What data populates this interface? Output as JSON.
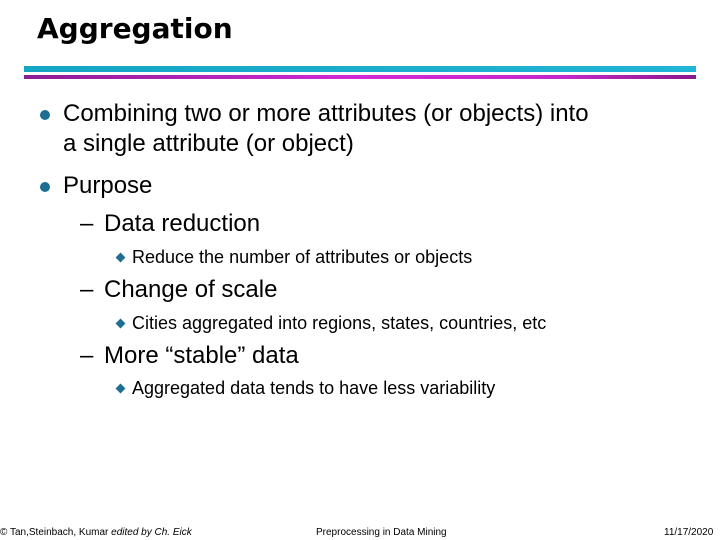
{
  "slide": {
    "title": "Aggregation",
    "bullets": [
      {
        "line1": "Combining two or more attributes (or objects) into",
        "line2": "a single attribute (or object)"
      },
      {
        "line1": "Purpose"
      }
    ],
    "sub_points": [
      {
        "label": "Data reduction",
        "detail": "Reduce the number of attributes or objects"
      },
      {
        "label": "Change of scale",
        "detail": "Cities aggregated into regions, states, countries, etc"
      },
      {
        "label": "More “stable” data",
        "detail": "Aggregated data tends to have less variability"
      }
    ],
    "dash": "–",
    "colors": {
      "bullet": "#1e6e94",
      "rule_top": "#1aacd0",
      "rule_bottom": "#c428c8"
    }
  },
  "footer": {
    "copyright": "© Tan,Steinbach, Kumar",
    "edited": "edited by Ch. Eick",
    "course": "Preprocessing in Data Mining",
    "date": "11/17/2020"
  }
}
